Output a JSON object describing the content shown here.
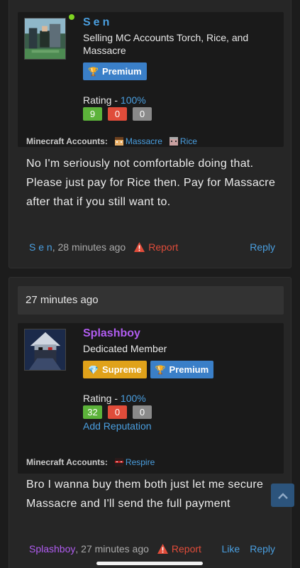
{
  "posts": [
    {
      "user": {
        "name": "Sen",
        "title": "Selling MC Accounts Torch, Rice, and Massacre",
        "online": true,
        "badges": [
          {
            "label": "Premium",
            "icon": "trophy-icon",
            "color": "#3a7fc8"
          }
        ],
        "rating_label": "Rating - ",
        "rating_pct": "100%",
        "positive": "9",
        "negative": "0",
        "neutral": "0"
      },
      "mc_label": "Minecraft Accounts:",
      "mc_accounts": [
        "Massacre",
        "Rice"
      ],
      "body": "No I'm seriously not comfortable doing that. Please just pay for Rice then. Pay for Massacre after that if you still want to.",
      "footer": {
        "author": "S e n",
        "time": ", 28 minutes ago",
        "report": "Report",
        "reply": "Reply"
      }
    },
    {
      "date": "27 minutes ago",
      "user": {
        "name": "Splashboy",
        "title": "Dedicated Member",
        "badges": [
          {
            "label": "Supreme",
            "icon": "diamond-icon",
            "color": "#e0a21a"
          },
          {
            "label": "Premium",
            "icon": "trophy-icon",
            "color": "#3a7fc8"
          }
        ],
        "rating_label": "Rating - ",
        "rating_pct": "100%",
        "positive": "32",
        "negative": "0",
        "neutral": "0",
        "add_rep": "Add Reputation"
      },
      "mc_label": "Minecraft Accounts:",
      "mc_accounts": [
        "Respire"
      ],
      "body": "Bro I wanna buy them both just let me secure Massacre and I'll send the full payment",
      "footer": {
        "author": "Splashboy",
        "time": ", 27 minutes ago",
        "report": "Report",
        "like": "Like",
        "reply": "Reply"
      }
    }
  ]
}
